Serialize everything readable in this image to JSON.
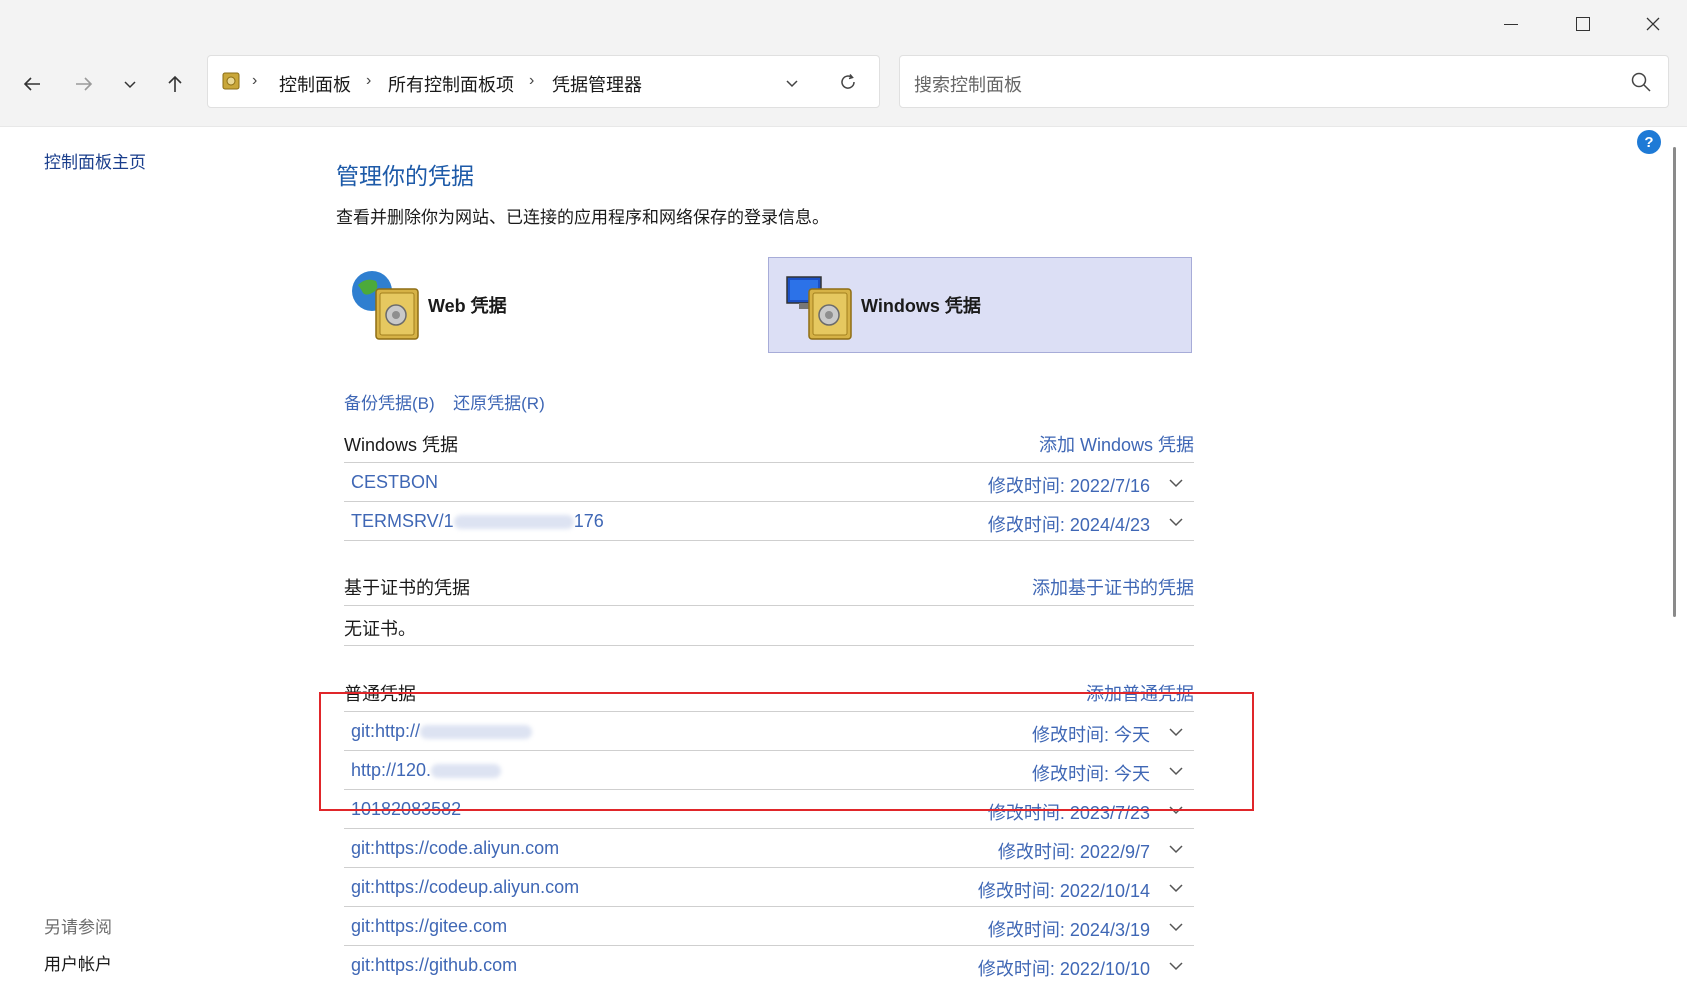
{
  "nav": {
    "breadcrumbs": [
      "控制面板",
      "所有控制面板项",
      "凭据管理器"
    ],
    "search_placeholder": "搜索控制面板"
  },
  "sidebar": {
    "home_link": "控制面板主页",
    "see_also_title": "另请参阅",
    "see_also_link": "用户帐户"
  },
  "main": {
    "title": "管理你的凭据",
    "subtitle": "查看并删除你为网站、已连接的应用程序和网络保存的登录信息。",
    "tabs": [
      {
        "label": "Web 凭据",
        "selected": false
      },
      {
        "label": "Windows 凭据",
        "selected": true
      }
    ],
    "backup_link": "备份凭据(B)",
    "restore_link": "还原凭据(R)"
  },
  "windows_credentials": {
    "title": "Windows 凭据",
    "add_label": "添加 Windows 凭据",
    "items": [
      {
        "name_prefix": "CESTBON",
        "name_suffix": "",
        "modified": "修改时间:  2022/7/16"
      },
      {
        "name_prefix": "TERMSRV/1",
        "name_suffix": "176",
        "modified": "修改时间:  2024/4/23"
      }
    ]
  },
  "cert_credentials": {
    "title": "基于证书的凭据",
    "add_label": "添加基于证书的凭据",
    "empty_text": "无证书。"
  },
  "generic_credentials": {
    "title": "普通凭据",
    "add_label": "添加普通凭据",
    "items": [
      {
        "name_prefix": "git:http://",
        "name_suffix": "",
        "modified": "修改时间:  今天"
      },
      {
        "name_prefix": "http://120.",
        "name_suffix": "",
        "modified": "修改时间:  今天"
      },
      {
        "name_prefix": "10182083582",
        "name_suffix": "",
        "modified": "修改时间:  2023/7/23"
      },
      {
        "name_prefix": "git:https://code.aliyun.com",
        "name_suffix": "",
        "modified": "修改时间:  2022/9/7"
      },
      {
        "name_prefix": "git:https://codeup.aliyun.com",
        "name_suffix": "",
        "modified": "修改时间:  2022/10/14"
      },
      {
        "name_prefix": "git:https://gitee.com",
        "name_suffix": "",
        "modified": "修改时间:  2024/3/19"
      },
      {
        "name_prefix": "git:https://github.com",
        "name_suffix": "",
        "modified": "修改时间:  2022/10/10"
      }
    ]
  },
  "colors": {
    "link": "#3f67b5",
    "title": "#1d5aa8",
    "highlight_box": "#e0262a",
    "selected_tab": "#dcdff5"
  }
}
